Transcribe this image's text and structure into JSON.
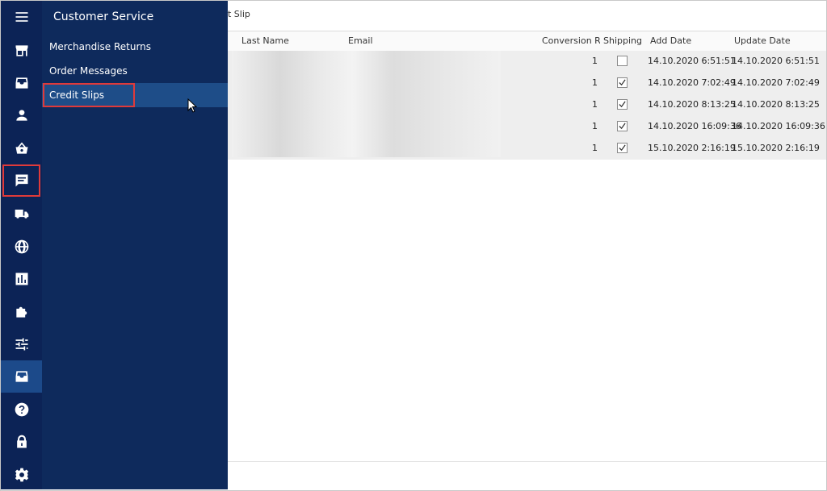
{
  "breadcrumb": "t Slip",
  "flyout": {
    "title": "Customer Service",
    "items": [
      {
        "label": "Merchandise Returns"
      },
      {
        "label": "Order Messages"
      },
      {
        "label": "Credit Slips"
      }
    ]
  },
  "rail_icons": [
    "menu-icon",
    "store-icon",
    "inbox-icon",
    "person-icon",
    "basket-icon",
    "chat-icon",
    "truck-icon",
    "globe-icon",
    "chart-icon",
    "puzzle-icon",
    "sliders-icon",
    "inbox-icon",
    "help-icon",
    "lock-icon",
    "gear-icon"
  ],
  "grid": {
    "columns": [
      "Last Name",
      "Email",
      "Conversion Ra",
      "Shipping",
      "Add Date",
      "Update Date"
    ],
    "rows": [
      {
        "conversion": "1",
        "shipping": false,
        "add_date": "14.10.2020 6:51:51",
        "update_date": "14.10.2020 6:51:51"
      },
      {
        "conversion": "1",
        "shipping": true,
        "add_date": "14.10.2020 7:02:49",
        "update_date": "14.10.2020 7:02:49"
      },
      {
        "conversion": "1",
        "shipping": true,
        "add_date": "14.10.2020 8:13:25",
        "update_date": "14.10.2020 8:13:25"
      },
      {
        "conversion": "1",
        "shipping": true,
        "add_date": "14.10.2020 16:09:36",
        "update_date": "14.10.2020 16:09:36"
      },
      {
        "conversion": "1",
        "shipping": true,
        "add_date": "15.10.2020 2:16:19",
        "update_date": "15.10.2020 2:16:19"
      }
    ]
  },
  "colors": {
    "rail": "#0c2356",
    "flyout": "#0e2a5c",
    "selected": "#1e4d88",
    "highlight": "#e03a3a"
  }
}
